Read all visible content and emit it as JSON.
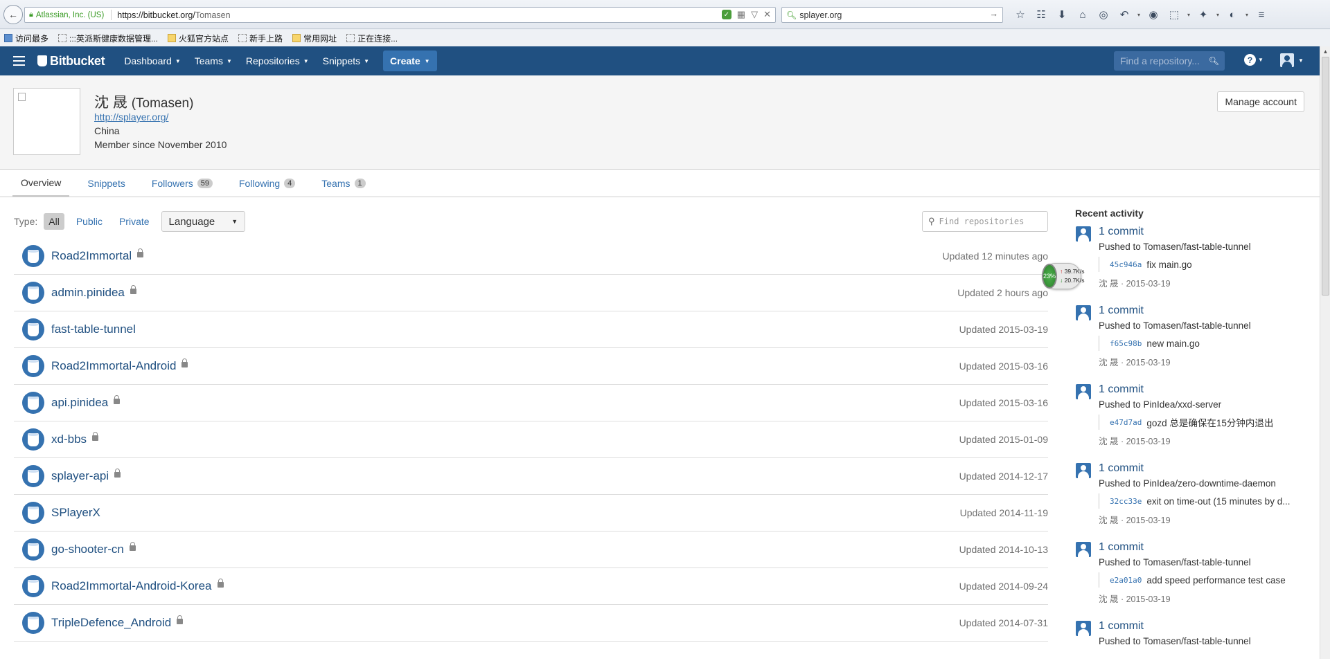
{
  "browser": {
    "ssl_org": "Atlassian, Inc. (US)",
    "url_host": "https://bitbucket.org/",
    "url_path": "Tomasen",
    "search_value": "splayer.org",
    "bookmarks": [
      {
        "label": "访问最多",
        "icon": "star"
      },
      {
        "label": ":::英派斯健康数据管理...",
        "icon": "page"
      },
      {
        "label": "火狐官方站点",
        "icon": "folder"
      },
      {
        "label": "新手上路",
        "icon": "page"
      },
      {
        "label": "常用网址",
        "icon": "folder"
      },
      {
        "label": "正在连接...",
        "icon": "page"
      }
    ],
    "toolbar_icons": [
      "star-icon",
      "reading-list-icon",
      "download-icon",
      "home-icon",
      "chat-icon",
      "undo-icon",
      "comment-icon",
      "crop-icon",
      "extension-icon",
      "globe-icon",
      "menu-icon"
    ]
  },
  "header": {
    "logo": "Bitbucket",
    "nav": [
      "Dashboard",
      "Teams",
      "Repositories",
      "Snippets"
    ],
    "create": "Create",
    "search_placeholder": "Find a repository..."
  },
  "profile": {
    "name": "沈 晟",
    "handle": "(Tomasen)",
    "url": "http://splayer.org/",
    "country": "China",
    "member_since": "Member since November 2010",
    "manage_button": "Manage account"
  },
  "tabs": [
    {
      "label": "Overview",
      "count": null
    },
    {
      "label": "Snippets",
      "count": null
    },
    {
      "label": "Followers",
      "count": "59"
    },
    {
      "label": "Following",
      "count": "4"
    },
    {
      "label": "Teams",
      "count": "1"
    }
  ],
  "filters": {
    "label": "Type:",
    "options": [
      "All",
      "Public",
      "Private"
    ],
    "active": "All",
    "language": "Language",
    "find_placeholder": "Find repositories"
  },
  "repos": [
    {
      "name": "Road2Immortal",
      "private": true,
      "updated": "Updated 12 minutes ago"
    },
    {
      "name": "admin.pinidea",
      "private": true,
      "updated": "Updated 2 hours ago"
    },
    {
      "name": "fast-table-tunnel",
      "private": false,
      "updated": "Updated 2015-03-19"
    },
    {
      "name": "Road2Immortal-Android",
      "private": true,
      "updated": "Updated 2015-03-16"
    },
    {
      "name": "api.pinidea",
      "private": true,
      "updated": "Updated 2015-03-16"
    },
    {
      "name": "xd-bbs",
      "private": true,
      "updated": "Updated 2015-01-09"
    },
    {
      "name": "splayer-api",
      "private": true,
      "updated": "Updated 2014-12-17"
    },
    {
      "name": "SPlayerX",
      "private": false,
      "updated": "Updated 2014-11-19"
    },
    {
      "name": "go-shooter-cn",
      "private": true,
      "updated": "Updated 2014-10-13"
    },
    {
      "name": "Road2Immortal-Android-Korea",
      "private": true,
      "updated": "Updated 2014-09-24"
    },
    {
      "name": "TripleDefence_Android",
      "private": true,
      "updated": "Updated 2014-07-31"
    }
  ],
  "activity": {
    "title": "Recent activity",
    "items": [
      {
        "title": "1 commit",
        "desc": "Pushed to Tomasen/fast-table-tunnel",
        "hash": "45c946a",
        "msg": "fix main.go",
        "meta": "沈 晟 · 2015-03-19"
      },
      {
        "title": "1 commit",
        "desc": "Pushed to Tomasen/fast-table-tunnel",
        "hash": "f65c98b",
        "msg": "new main.go",
        "meta": "沈 晟 · 2015-03-19"
      },
      {
        "title": "1 commit",
        "desc": "Pushed to PinIdea/xxd-server",
        "hash": "e47d7ad",
        "msg": "gozd 总是确保在15分钟内退出",
        "meta": "沈 晟 · 2015-03-19"
      },
      {
        "title": "1 commit",
        "desc": "Pushed to PinIdea/zero-downtime-daemon",
        "hash": "32cc33e",
        "msg": "exit on time-out (15 minutes by d...",
        "meta": "沈 晟 · 2015-03-19"
      },
      {
        "title": "1 commit",
        "desc": "Pushed to Tomasen/fast-table-tunnel",
        "hash": "e2a01a0",
        "msg": "add speed performance test case",
        "meta": "沈 晟 · 2015-03-19"
      },
      {
        "title": "1 commit",
        "desc": "Pushed to Tomasen/fast-table-tunnel",
        "hash": "",
        "msg": "",
        "meta": ""
      }
    ]
  },
  "speed_widget": {
    "percent": "23%",
    "up": "39.7K/s",
    "down": "20.7K/s"
  }
}
